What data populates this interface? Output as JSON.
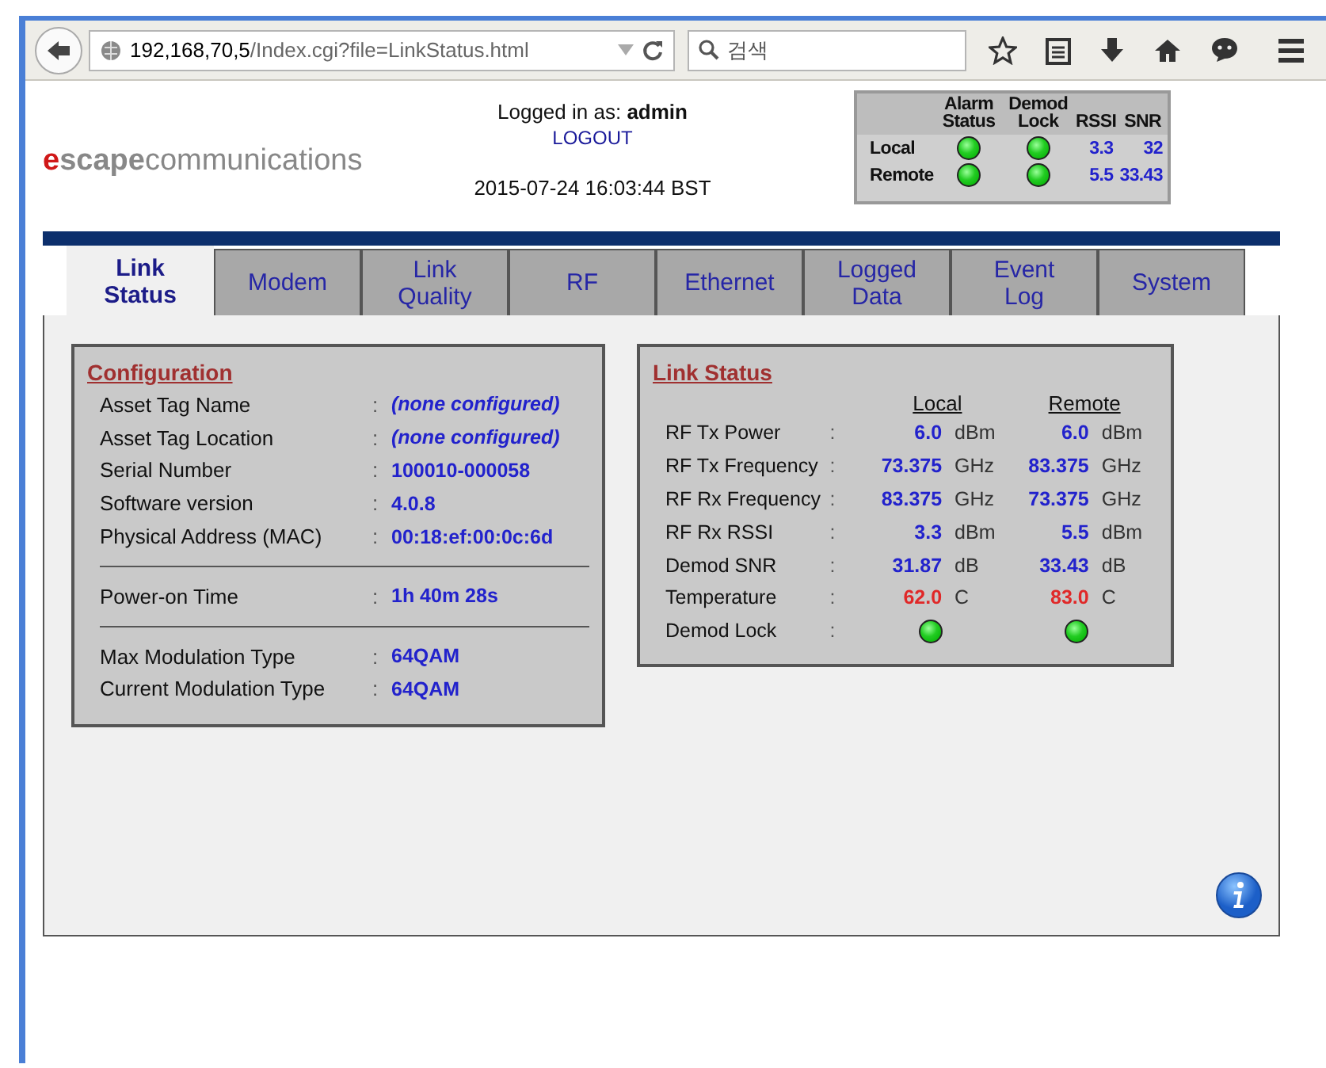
{
  "browser": {
    "url_host": "192,168,70,5",
    "url_path": "/Index.cgi?file=LinkStatus.html",
    "search_placeholder": "검색"
  },
  "header": {
    "logo": {
      "accent": "e",
      "bold": "scape",
      "rest": "communications"
    },
    "login_label": "Logged in as:",
    "user": "admin",
    "logout": "LOGOUT",
    "timestamp": "2015-07-24 16:03:44 BST",
    "summary": {
      "columns": [
        "Alarm Status",
        "Demod Lock",
        "RSSI",
        "SNR"
      ],
      "rows": [
        {
          "name": "Local",
          "alarm_ok": true,
          "lock_ok": true,
          "rssi": "3.3",
          "snr": "32"
        },
        {
          "name": "Remote",
          "alarm_ok": true,
          "lock_ok": true,
          "rssi": "5.5",
          "snr": "33.43"
        }
      ]
    }
  },
  "tabs": [
    {
      "label": "Link Status",
      "selected": true
    },
    {
      "label": "Modem",
      "selected": false
    },
    {
      "label": "Link Quality",
      "selected": false
    },
    {
      "label": "RF",
      "selected": false
    },
    {
      "label": "Ethernet",
      "selected": false
    },
    {
      "label": "Logged Data",
      "selected": false
    },
    {
      "label": "Event Log",
      "selected": false
    },
    {
      "label": "System",
      "selected": false
    }
  ],
  "configuration": {
    "title": "Configuration",
    "separator": ":",
    "groups": [
      [
        {
          "label": "Asset Tag Name",
          "value": "(none configured)",
          "unset": true
        },
        {
          "label": "Asset Tag Location",
          "value": "(none configured)",
          "unset": true
        },
        {
          "label": "Serial Number",
          "value": "100010-000058",
          "unset": false
        },
        {
          "label": "Software version",
          "value": "4.0.8",
          "unset": false
        },
        {
          "label": "Physical Address (MAC)",
          "value": "00:18:ef:00:0c:6d",
          "unset": false
        }
      ],
      [
        {
          "label": "Power-on Time",
          "value": "1h 40m 28s",
          "unset": false
        }
      ],
      [
        {
          "label": "Max Modulation Type",
          "value": "64QAM",
          "unset": false
        },
        {
          "label": "Current Modulation Type",
          "value": "64QAM",
          "unset": false
        }
      ]
    ]
  },
  "link_status": {
    "title": "Link Status",
    "separator": ":",
    "columns": [
      "Local",
      "Remote"
    ],
    "rows": [
      {
        "kind": "reading",
        "label": "RF Tx Power",
        "local": {
          "value": "6.0",
          "unit": "dBm",
          "warning": false
        },
        "remote": {
          "value": "6.0",
          "unit": "dBm",
          "warning": false
        }
      },
      {
        "kind": "reading",
        "label": "RF Tx Frequency",
        "local": {
          "value": "73.375",
          "unit": "GHz",
          "warning": false
        },
        "remote": {
          "value": "83.375",
          "unit": "GHz",
          "warning": false
        }
      },
      {
        "kind": "reading",
        "label": "RF Rx Frequency",
        "local": {
          "value": "83.375",
          "unit": "GHz",
          "warning": false
        },
        "remote": {
          "value": "73.375",
          "unit": "GHz",
          "warning": false
        }
      },
      {
        "kind": "reading",
        "label": "RF Rx RSSI",
        "local": {
          "value": "3.3",
          "unit": "dBm",
          "warning": false
        },
        "remote": {
          "value": "5.5",
          "unit": "dBm",
          "warning": false
        }
      },
      {
        "kind": "reading",
        "label": "Demod SNR",
        "local": {
          "value": "31.87",
          "unit": "dB",
          "warning": false
        },
        "remote": {
          "value": "33.43",
          "unit": "dB",
          "warning": false
        }
      },
      {
        "kind": "reading",
        "label": "Temperature",
        "local": {
          "value": "62.0",
          "unit": "C",
          "warning": true
        },
        "remote": {
          "value": "83.0",
          "unit": "C",
          "warning": true
        }
      },
      {
        "kind": "led",
        "label": "Demod Lock",
        "local": {
          "ok": true
        },
        "remote": {
          "ok": true
        }
      }
    ]
  }
}
